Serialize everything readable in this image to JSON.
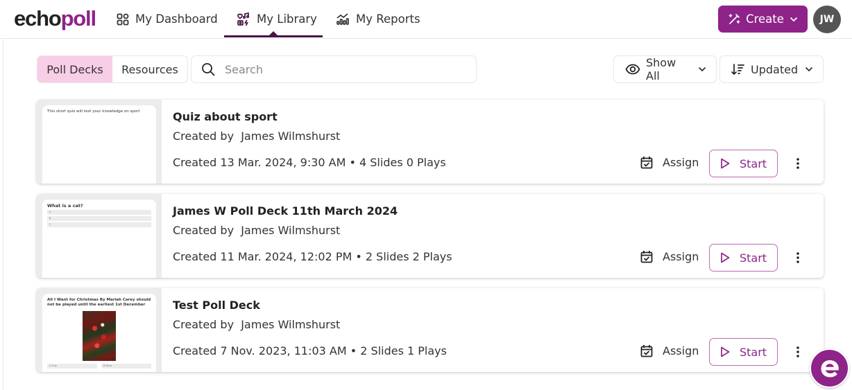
{
  "brand": {
    "logo_main": "echo",
    "logo_accent": "poll",
    "accent_color": "#8e2389"
  },
  "nav": {
    "items": [
      {
        "label": "My Dashboard",
        "icon": "dashboard-icon",
        "active": false
      },
      {
        "label": "My Library",
        "icon": "library-icon",
        "active": true
      },
      {
        "label": "My Reports",
        "icon": "reports-icon",
        "active": false
      }
    ]
  },
  "header": {
    "create_label": "Create",
    "avatar_initials": "JW"
  },
  "toolbar": {
    "tabs": [
      {
        "label": "Poll Decks",
        "active": true
      },
      {
        "label": "Resources",
        "active": false
      }
    ],
    "search": {
      "placeholder": "Search",
      "value": ""
    },
    "filter": {
      "label": "Show All",
      "icon": "eye-icon"
    },
    "sort": {
      "label": "Updated",
      "icon": "sort-icon"
    }
  },
  "decks": [
    {
      "title": "Quiz about sport",
      "author": "Created by  James Wilmshurst",
      "meta": "Created 13 Mar. 2024, 9:30 AM • 4 Slides 0 Plays",
      "thumbnail_text": "This short quiz will test your knowledge on sport",
      "assign_label": "Assign",
      "start_label": "Start"
    },
    {
      "title": "James W Poll Deck 11th March 2024",
      "author": "Created by  James Wilmshurst",
      "meta": "Created 11 Mar. 2024, 12:02 PM • 2 Slides 2 Plays",
      "thumbnail_text": "What is a cat?",
      "thumbnail_options": [
        "A",
        "B",
        "C"
      ],
      "assign_label": "Assign",
      "start_label": "Start"
    },
    {
      "title": "Test Poll Deck",
      "author": "Created by  James Wilmshurst",
      "meta": "Created 7 Nov. 2023, 11:03 AM • 2 Slides 1 Plays",
      "thumbnail_text": "All I Want for Christmas By Mariah Carey should not be played until the earliest 1st December",
      "thumbnail_options": [
        "A  True",
        "B  False"
      ],
      "assign_label": "Assign",
      "start_label": "Start"
    }
  ],
  "help_widget": {
    "glyph": "e"
  }
}
